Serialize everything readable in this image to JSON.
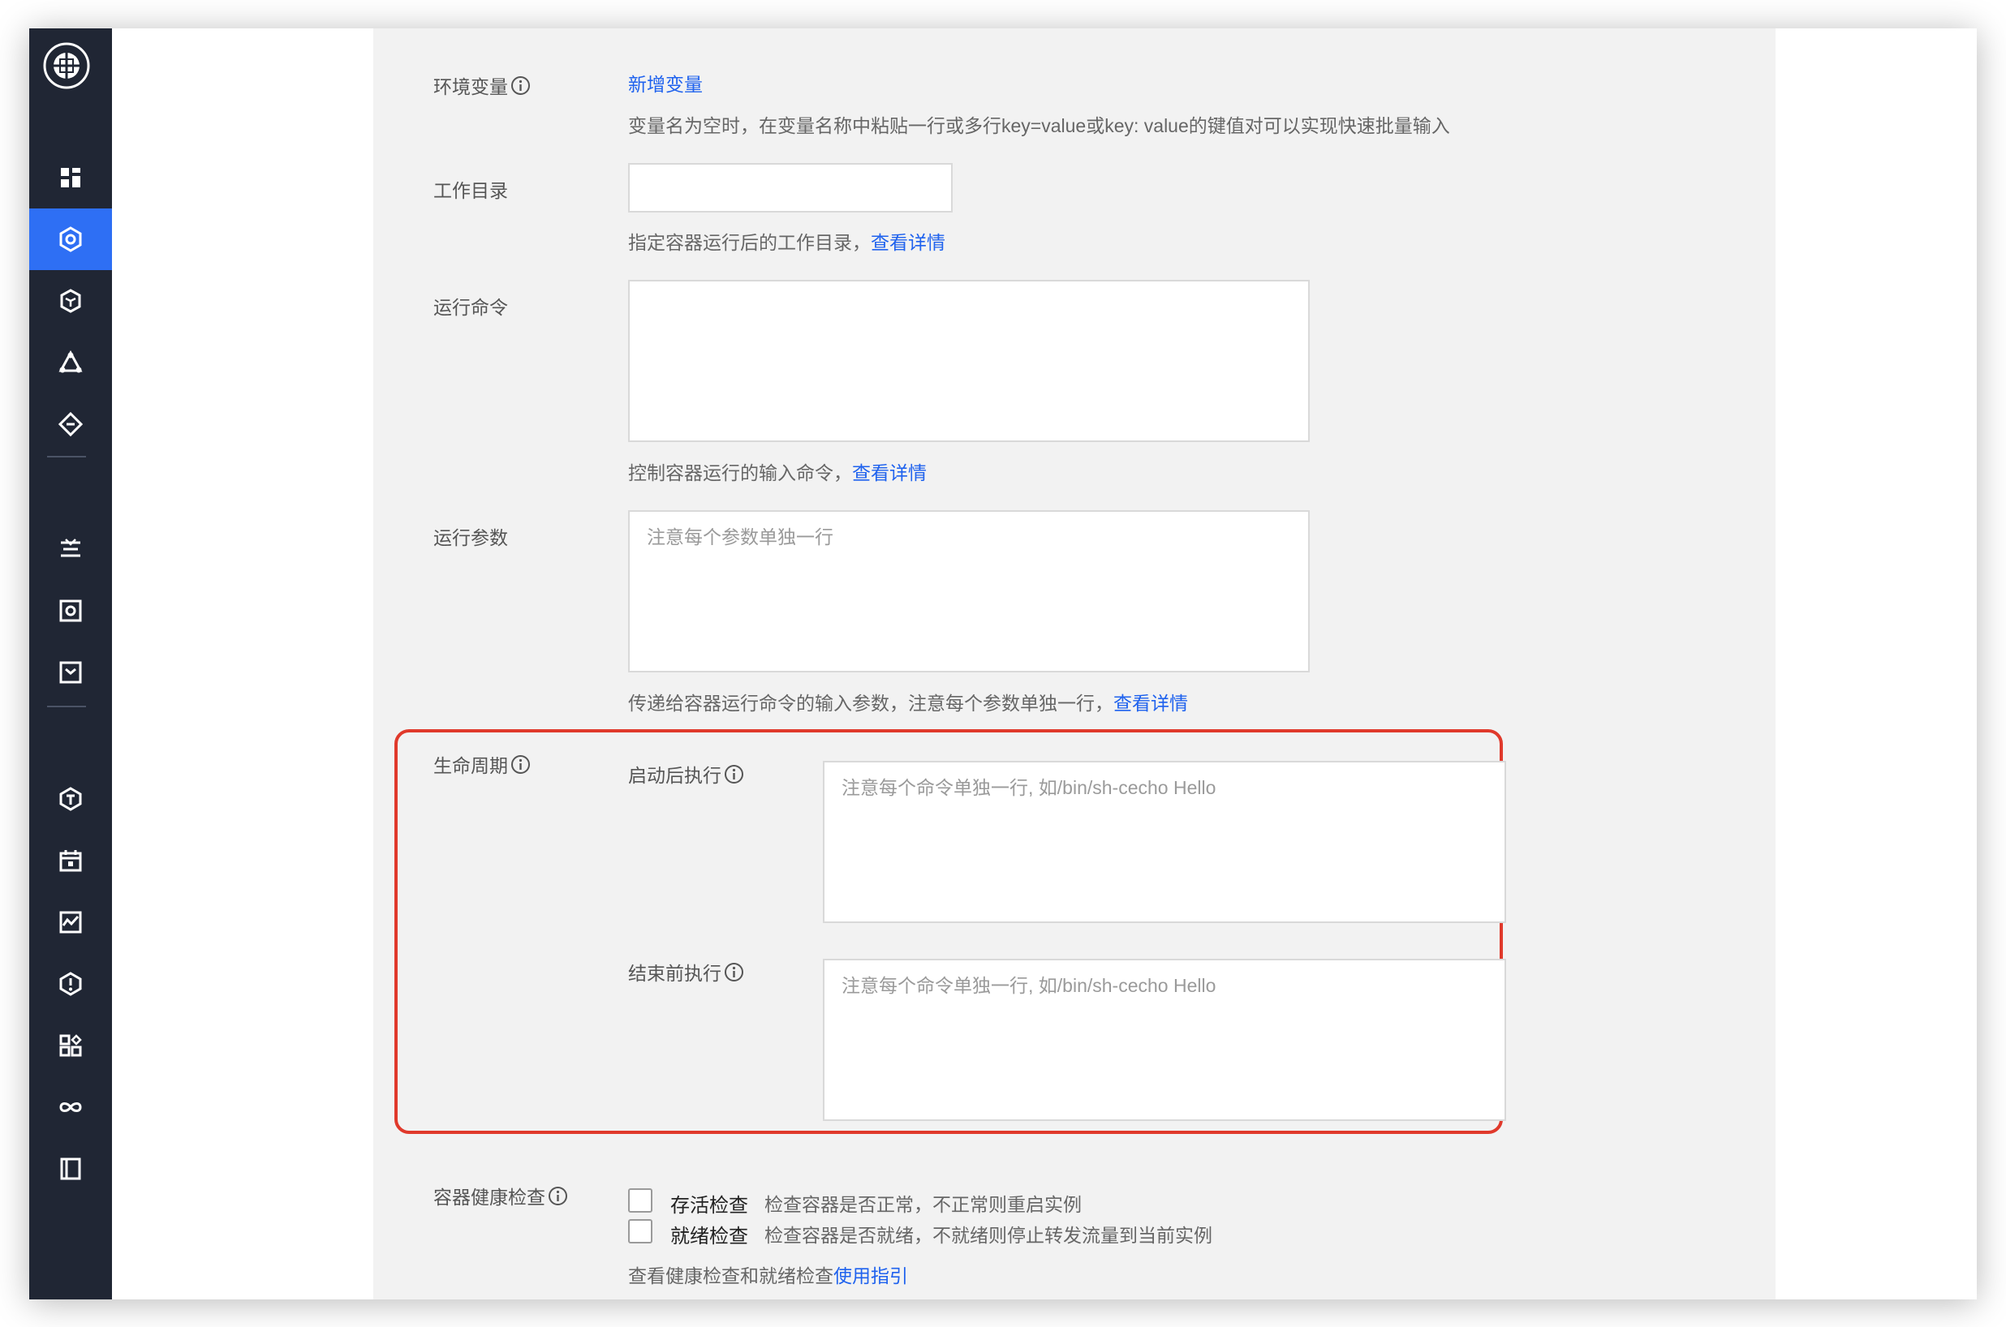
{
  "sidebar": {
    "logo_icon": "globe-logo-icon",
    "items": [
      {
        "icon": "dashboard-icon",
        "active": false
      },
      {
        "icon": "cube-service-icon",
        "active": true
      },
      {
        "icon": "network-cube-icon",
        "active": false
      },
      {
        "icon": "triangle-nodes-icon",
        "active": false
      },
      {
        "icon": "diamond-link-icon",
        "active": false
      },
      {
        "icon": "filter-layers-icon",
        "active": false
      },
      {
        "icon": "monitor-square-icon",
        "active": false
      },
      {
        "icon": "inbox-box-icon",
        "active": false
      },
      {
        "icon": "hexagon-t-icon",
        "active": false
      },
      {
        "icon": "calendar-icon",
        "active": false
      },
      {
        "icon": "chart-monitor-icon",
        "active": false
      },
      {
        "icon": "shield-alert-icon",
        "active": false
      },
      {
        "icon": "grid-apps-icon",
        "active": false
      },
      {
        "icon": "infinity-icon",
        "active": false
      },
      {
        "icon": "book-icon",
        "active": false
      }
    ]
  },
  "form": {
    "env": {
      "label": "环境变量",
      "add_link": "新增变量",
      "hint": "变量名为空时，在变量名称中粘贴一行或多行key=value或key: value的键值对可以实现快速批量输入"
    },
    "workdir": {
      "label": "工作目录",
      "value": "",
      "hint": "指定容器运行后的工作目录，",
      "link": "查看详情"
    },
    "command": {
      "label": "运行命令",
      "value": "",
      "hint": "控制容器运行的输入命令，",
      "link": "查看详情"
    },
    "args": {
      "label": "运行参数",
      "placeholder": "注意每个参数单独一行",
      "hint": "传递给容器运行命令的输入参数，注意每个参数单独一行，",
      "link": "查看详情"
    },
    "lifecycle": {
      "label": "生命周期",
      "post_start_label": "启动后执行",
      "post_start_placeholder": "注意每个命令单独一行, 如/bin/sh-cecho Hello",
      "pre_stop_label": "结束前执行",
      "pre_stop_placeholder": "注意每个命令单独一行, 如/bin/sh-cecho Hello"
    },
    "health": {
      "label": "容器健康检查",
      "liveness_title": "存活检查",
      "liveness_desc": "检查容器是否正常，不正常则重启实例",
      "readiness_title": "就绪检查",
      "readiness_desc": "检查容器是否就绪，不就绪则停止转发流量到当前实例",
      "guide_text": "查看健康检查和就绪检查",
      "guide_link": "使用指引"
    }
  }
}
